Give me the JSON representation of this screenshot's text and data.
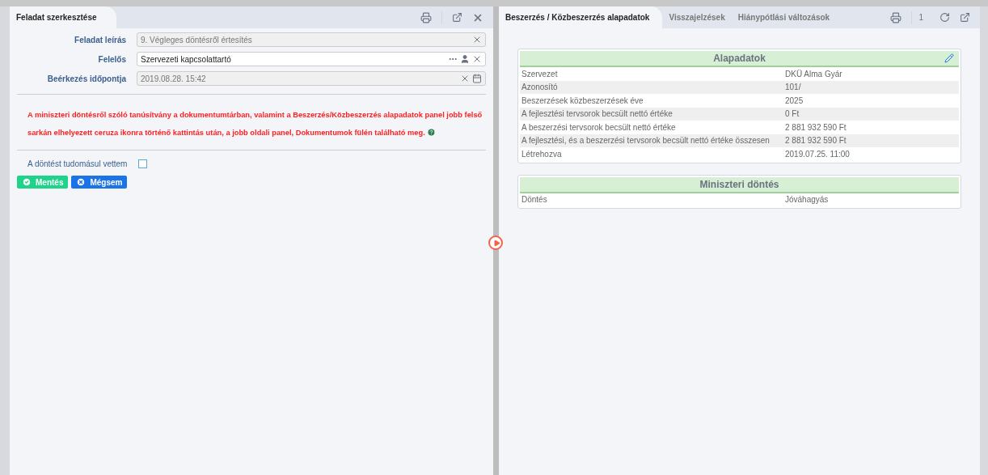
{
  "left_panel": {
    "title": "Feladat szerkesztése",
    "fields": [
      {
        "label": "Feladat leírás",
        "value": "9. Végleges döntésről értesítés",
        "disabled": true,
        "kind": "text"
      },
      {
        "label": "Felelős",
        "value": "Szervezeti kapcsolattartó",
        "disabled": false,
        "kind": "lookup"
      },
      {
        "label": "Beérkezés időpontja",
        "value": "2019.08.28. 15:42",
        "disabled": true,
        "kind": "date"
      }
    ],
    "notice": "A miniszteri döntésről szóló tanúsítvány a dokumentumtárban, valamint a Beszerzés/Közbeszerzés alapadatok panel jobb felső sarkán elhelyezett ceruza ikonra történő kattintás után, a jobb oldali panel, Dokumentumok fülén található meg.",
    "checkbox": {
      "label": "A döntést tudomásul vettem",
      "checked": false
    },
    "buttons": [
      {
        "label": "Mentés",
        "kind": "save"
      },
      {
        "label": "Mégsem",
        "kind": "cancel"
      }
    ]
  },
  "right_panel": {
    "tabs": [
      {
        "label": "Beszerzés / Közbeszerzés alapadatok",
        "selected": true
      },
      {
        "label": "Visszajelzések",
        "selected": false
      },
      {
        "label": "Hiánypótlási változások",
        "selected": false
      }
    ],
    "count": "1",
    "sections": [
      {
        "title": "Alapadatok",
        "editable": true,
        "rows": [
          {
            "label": "Szervezet",
            "value": "DKÜ Alma Gyár"
          },
          {
            "label": "Azonosító",
            "value": "101/"
          },
          {
            "label": "Beszerzések közbeszerzések éve",
            "value": "2025"
          },
          {
            "label": "A fejlesztési tervsorok becsült nettó értéke",
            "value": "0 Ft"
          },
          {
            "label": "A beszerzési tervsorok becsült nettó értéke",
            "value": "2 881 932 590 Ft"
          },
          {
            "label": "A fejlesztési, és a beszerzési tervsorok becsült nettó értéke összesen",
            "value": "2 881 932 590 Ft"
          },
          {
            "label": "Létrehozva",
            "value": "2019.07.25. 11:00"
          }
        ]
      },
      {
        "title": "Miniszteri döntés",
        "editable": false,
        "rows": [
          {
            "label": "Döntés",
            "value": "Jóváhagyás"
          }
        ]
      }
    ]
  }
}
